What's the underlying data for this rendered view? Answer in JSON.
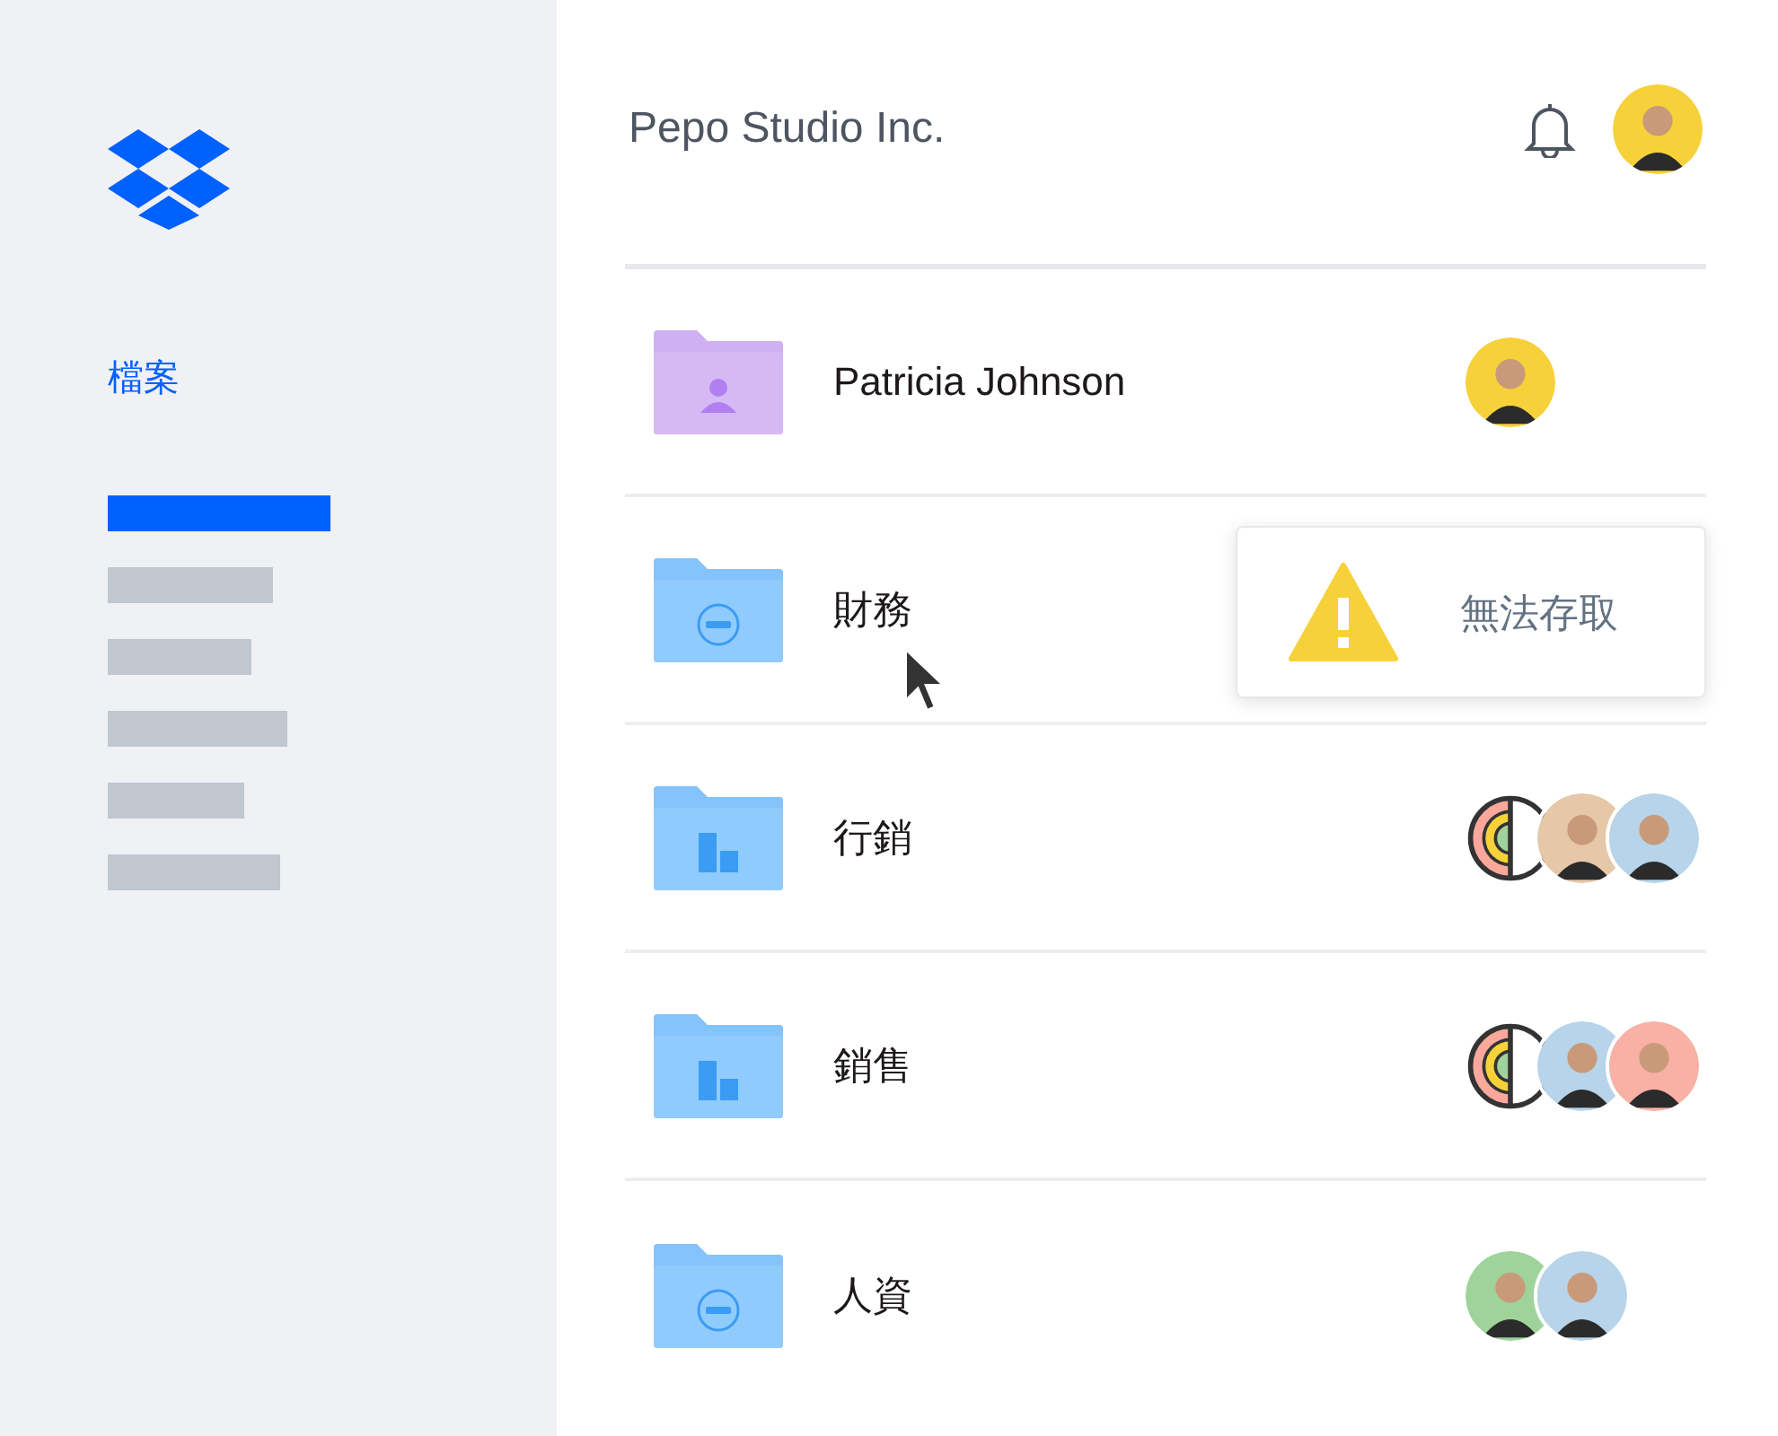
{
  "sidebar": {
    "title": {
      "label": "檔案",
      "selected": true
    },
    "items": [
      {
        "selected": true
      },
      {
        "selected": false
      },
      {
        "selected": false
      },
      {
        "selected": false
      },
      {
        "selected": false
      },
      {
        "selected": false
      }
    ]
  },
  "header": {
    "title": "Pepo Studio Inc.",
    "avatar": {
      "kind": "person",
      "color": "#f7d13a"
    }
  },
  "folders": [
    {
      "name": "Patricia Johnson",
      "kind": "personal",
      "members": [
        {
          "kind": "person",
          "color": "#f7d13a"
        }
      ]
    },
    {
      "name": "財務",
      "kind": "restricted",
      "tooltip": {
        "text": "無法存取"
      }
    },
    {
      "name": "行銷",
      "kind": "team",
      "members": [
        {
          "kind": "team-logo"
        },
        {
          "kind": "person",
          "color": "#e6c7a8"
        },
        {
          "kind": "person",
          "color": "#b7d4ea"
        }
      ]
    },
    {
      "name": "銷售",
      "kind": "team",
      "members": [
        {
          "kind": "team-logo"
        },
        {
          "kind": "person",
          "color": "#b7d4ea"
        },
        {
          "kind": "person",
          "color": "#f9b0a5"
        }
      ]
    },
    {
      "name": "人資",
      "kind": "restricted",
      "members": [
        {
          "kind": "person",
          "color": "#9fd39a"
        },
        {
          "kind": "person",
          "color": "#b7d4ea"
        }
      ]
    }
  ]
}
